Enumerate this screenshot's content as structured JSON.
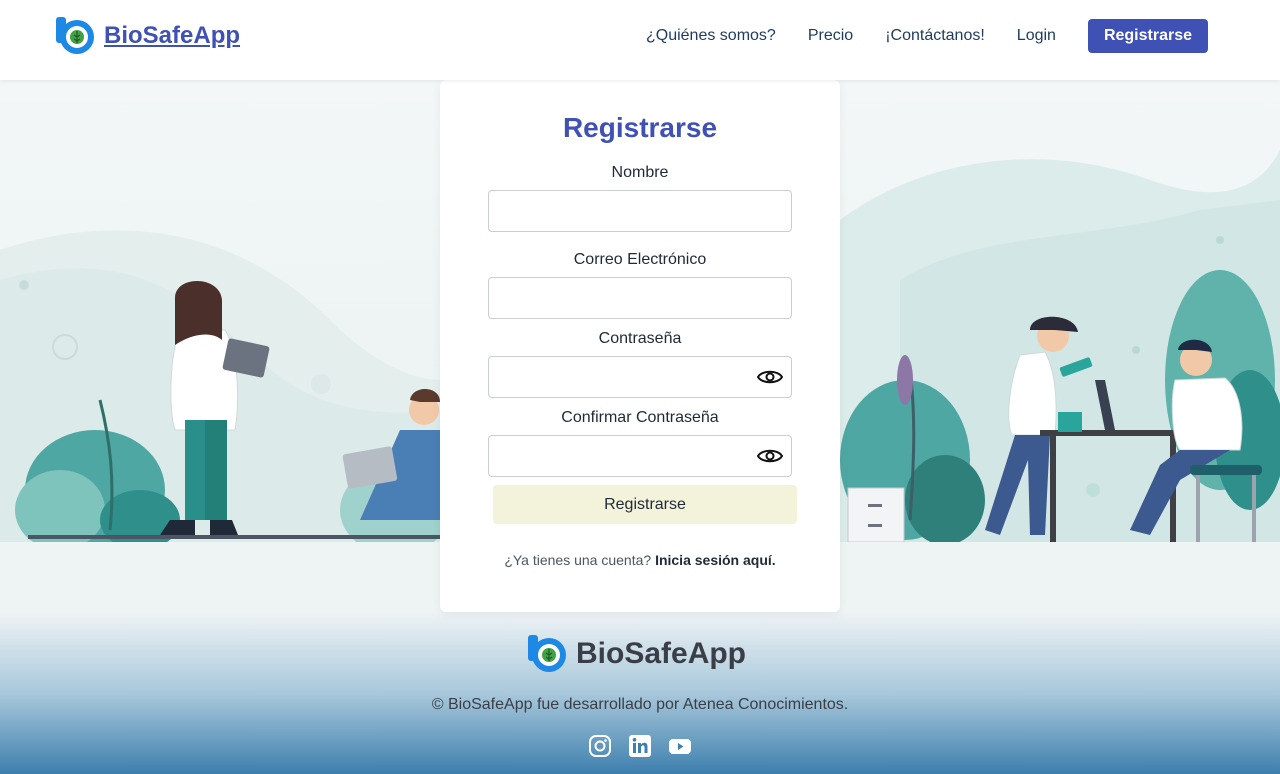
{
  "header": {
    "brand": "BioSafeApp",
    "nav": {
      "about": "¿Quiénes somos?",
      "pricing": "Precio",
      "contact": "¡Contáctanos!",
      "login": "Login",
      "register": "Registrarse"
    }
  },
  "form": {
    "title": "Registrarse",
    "name_label": "Nombre",
    "name_value": "",
    "email_label": "Correo Electrónico",
    "email_value": "",
    "password_label": "Contraseña",
    "password_value": "",
    "confirm_label": "Confirmar Contraseña",
    "confirm_value": "",
    "submit_label": "Registrarse",
    "have_account": "¿Ya tienes una cuenta?",
    "login_link": "Inicia sesión aquí."
  },
  "footer": {
    "brand": "BioSafeApp",
    "copyright": "© BioSafeApp fue desarrollado por Atenea Conocimientos.",
    "socials": [
      "instagram-icon",
      "linkedin-icon",
      "youtube-icon"
    ]
  },
  "colors": {
    "primary": "#3f51b5",
    "submit_bg": "#f3f3dc",
    "footer_bottom": "#3d7fae"
  }
}
